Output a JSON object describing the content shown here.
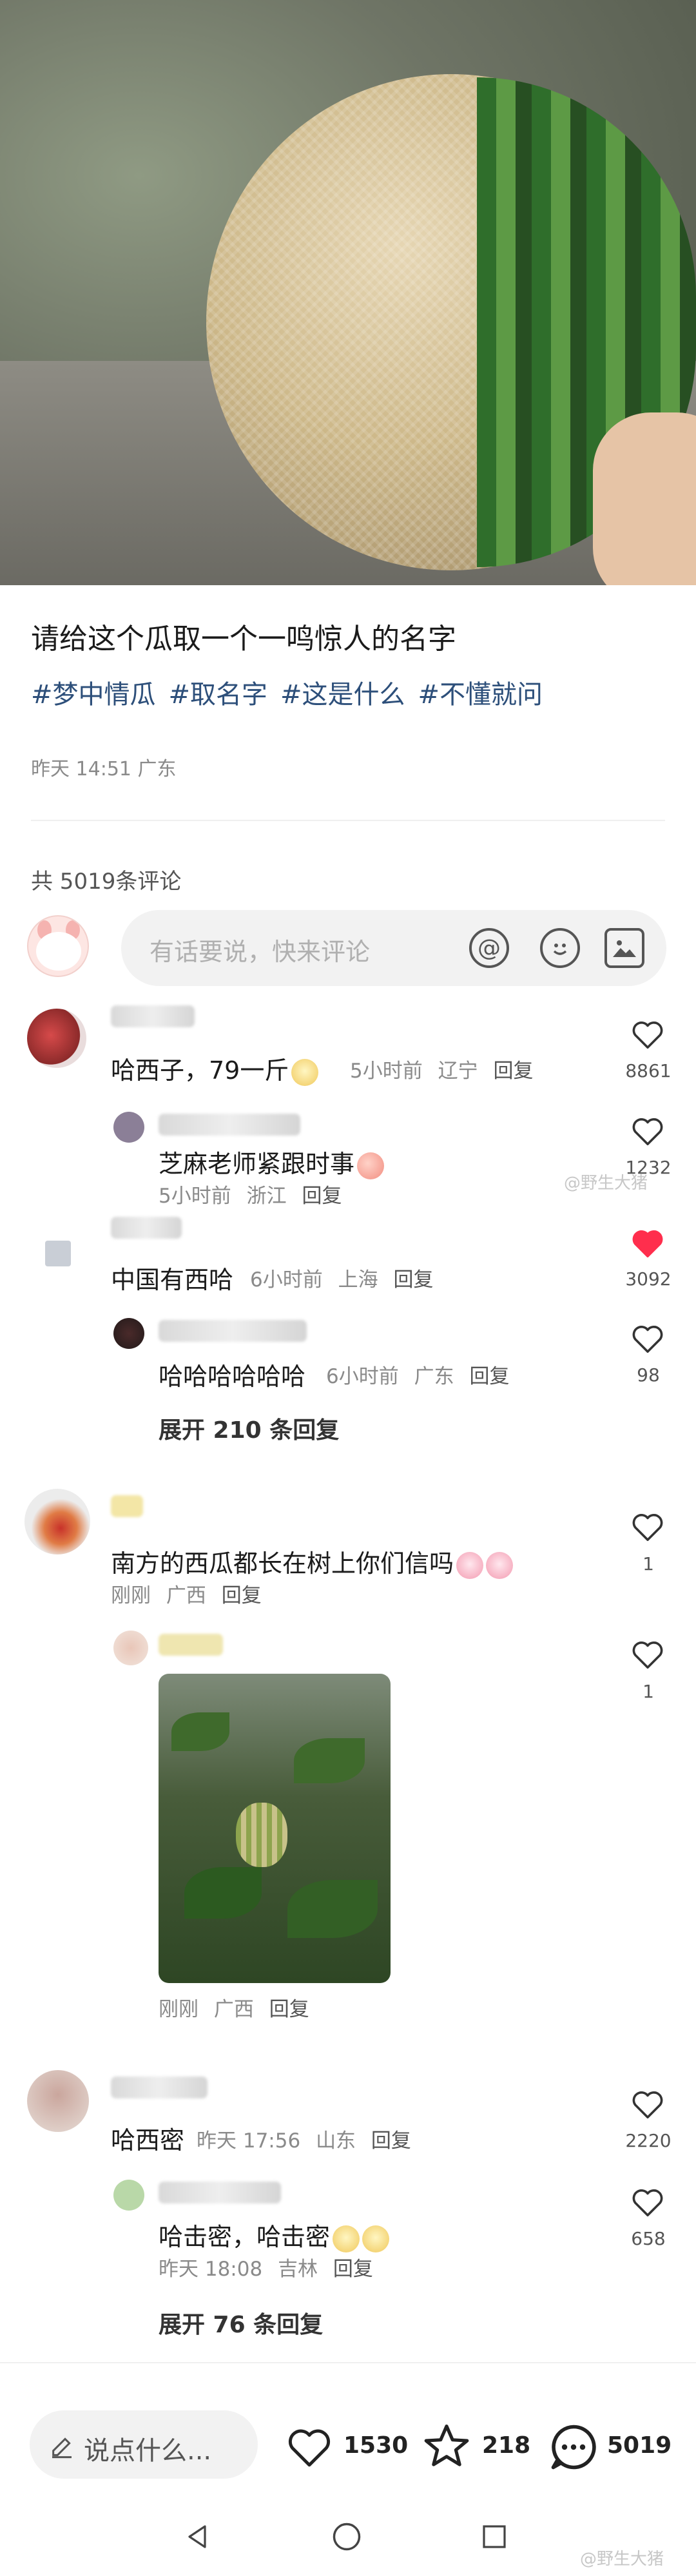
{
  "post": {
    "title": "请给这个瓜取一个一鸣惊人的名字",
    "tags": [
      "#梦中情瓜",
      "#取名字",
      "#这是什么",
      "#不懂就问"
    ],
    "meta": "昨天 14:51 广东"
  },
  "comments_header": {
    "count_text": "共 5019条评论",
    "input_placeholder": "有话要说，快来评论"
  },
  "comments": [
    {
      "name": "…玹",
      "text": "哈西子，79一斤",
      "time": "5小时前",
      "location": "辽宁",
      "reply_label": "回复",
      "likes": "8861",
      "liked": false,
      "replies": [
        {
          "name": "…芸嘞",
          "text": "芝麻老师紧跟时事",
          "time": "5小时前",
          "location": "浙江",
          "reply_label": "回复",
          "likes": "1232"
        }
      ]
    },
    {
      "name": "…大马",
      "text": "中国有西哈",
      "time": "6小时前",
      "location": "上海",
      "reply_label": "回复",
      "likes": "3092",
      "liked": true,
      "replies": [
        {
          "name": "…一厉啜",
          "text": "哈哈哈哈哈哈",
          "time": "6小时前",
          "location": "广东",
          "reply_label": "回复",
          "likes": "98"
        }
      ],
      "expand": "展开 210 条回复"
    },
    {
      "name": "",
      "text": "南方的西瓜都长在树上你们信吗",
      "time": "刚刚",
      "location": "广西",
      "reply_label": "回复",
      "likes": "1",
      "liked": false,
      "replies": [
        {
          "name": "",
          "text": "",
          "time": "刚刚",
          "location": "广西",
          "reply_label": "回复",
          "likes": "1",
          "has_image": true
        }
      ]
    },
    {
      "name": "…日",
      "text": "哈西密",
      "time": "昨天 17:56",
      "location": "山东",
      "reply_label": "回复",
      "likes": "2220",
      "liked": false,
      "replies": [
        {
          "name": "…痞老板",
          "text": "哈击密，哈击密",
          "time": "昨天 18:08",
          "location": "吉林",
          "reply_label": "回复",
          "likes": "658"
        }
      ],
      "expand": "展开 76 条回复"
    }
  ],
  "watermark": "@野生大猪",
  "bottom_bar": {
    "say_placeholder": "说点什么...",
    "likes": "1530",
    "stars": "218",
    "comments": "5019"
  },
  "colors": {
    "accent_red": "#ff2e4d",
    "tag_blue": "#2d4f7a"
  },
  "icons": [
    "pencil-icon",
    "heart-icon",
    "star-icon",
    "comment-icon",
    "at-icon",
    "emoji-icon",
    "image-icon",
    "back-triangle-icon",
    "home-circle-icon",
    "recent-square-icon"
  ]
}
